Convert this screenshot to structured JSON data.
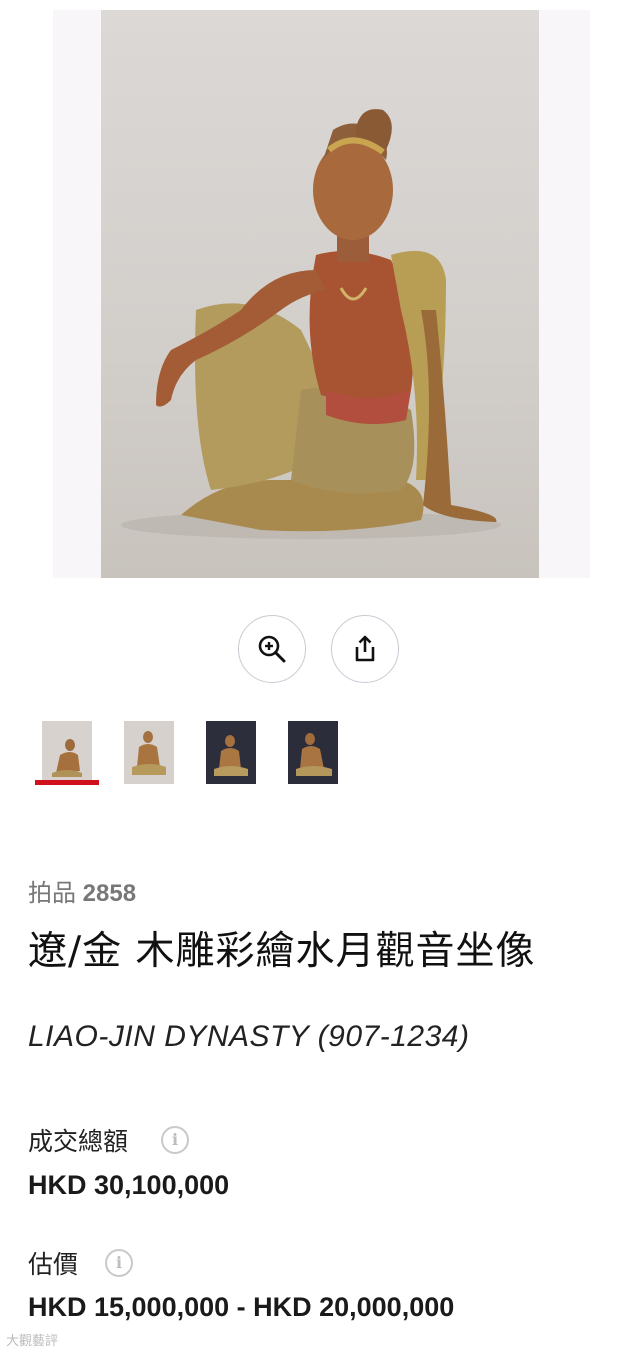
{
  "media": {
    "hero_alt": "Seated Water-Moon Guanyin wood sculpture",
    "zoom_icon": "zoom-in-icon",
    "share_icon": "share-icon",
    "thumbnails": [
      {
        "name": "thumbnail-1",
        "active": true
      },
      {
        "name": "thumbnail-2",
        "active": false
      },
      {
        "name": "thumbnail-3",
        "active": false
      },
      {
        "name": "thumbnail-4",
        "active": false
      }
    ]
  },
  "lot": {
    "prefix": "拍品",
    "number": "2858",
    "title": "遼/金 木雕彩繪水月觀音坐像",
    "subtitle": "LIAO-JIN DYNASTY (907-1234)"
  },
  "price": {
    "sold_label": "成交總額",
    "sold_value": "HKD 30,100,000",
    "estimate_label": "估價",
    "estimate_value": "HKD 15,000,000 - HKD 20,000,000",
    "info_icon": "info-icon"
  },
  "watermark": "大觀藝評",
  "colors": {
    "active_indicator": "#d0101b",
    "muted_text": "#777777"
  }
}
